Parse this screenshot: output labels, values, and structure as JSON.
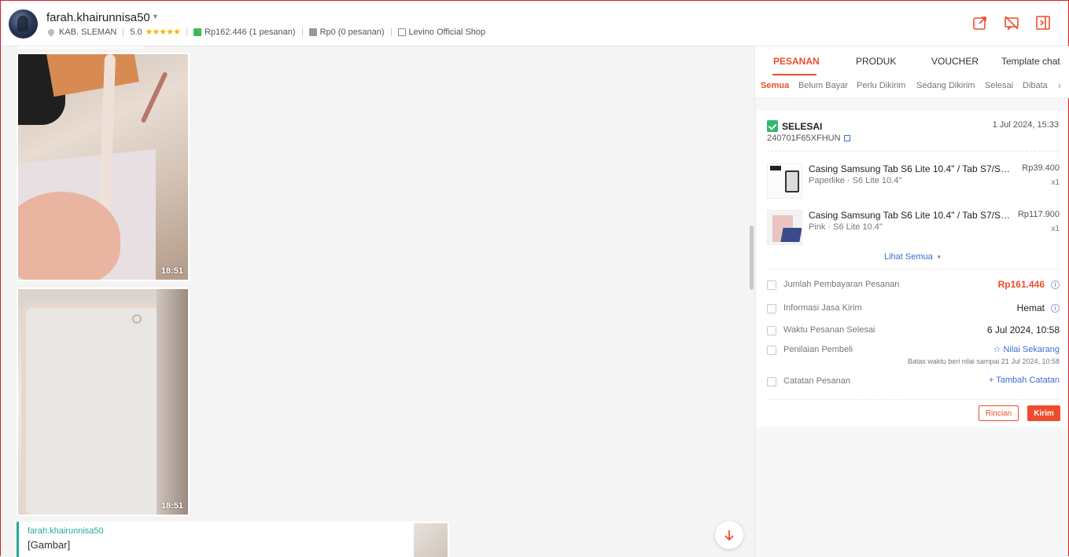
{
  "header": {
    "username": "farah.khairunnisa50",
    "location": "KAB. SLEMAN",
    "rating": "5.0",
    "stars": "★★★★★",
    "spent": "Rp162.446 (1 pesanan)",
    "unpaid": "Rp0 (0 pesanan)",
    "shop": "Levino Official Shop",
    "accent_color": "#ee4d2d"
  },
  "chat": {
    "image_messages": [
      {
        "time": "18:51"
      },
      {
        "time": "18:51"
      }
    ],
    "reply": {
      "name": "farah.khairunnisa50",
      "text": "[Gambar]"
    }
  },
  "panel": {
    "tabs": [
      "PESANAN",
      "PRODUK",
      "VOUCHER",
      "Template chat"
    ],
    "active_tab": "PESANAN",
    "subtabs": [
      "Semua",
      "Belum Bayar",
      "Perlu Dikirim",
      "Sedang Dikirim",
      "Selesai",
      "Dibata"
    ],
    "active_subtab": "Semua",
    "order": {
      "status": "SELESAI",
      "date": "1 Jul 2024, 15:33",
      "id": "240701F65XFHUN",
      "items": [
        {
          "name": "Casing Samsung Tab S6 Lite 10.4\" / Tab S7/S8/...",
          "variant": "Paperlike · S6 Lite 10.4\"",
          "price": "Rp39.400",
          "qty": "x1"
        },
        {
          "name": "Casing Samsung Tab S6 Lite 10.4\" / Tab S7/S8...",
          "variant": "Pink · S6 Lite 10.4\"",
          "price": "Rp117.900",
          "qty": "x1"
        }
      ],
      "see_all": "Lihat Semua",
      "payment_label": "Jumlah Pembayaran Pesanan",
      "payment_value": "Rp161.446",
      "shipping_label": "Informasi Jasa Kirim",
      "shipping_value": "Hemat",
      "completed_label": "Waktu Pesanan Selesai",
      "completed_value": "6 Jul 2024, 10:58",
      "rating_label": "Penilaian Pembeli",
      "rating_link": "☆ Nilai Sekarang",
      "rating_deadline": "Batas waktu beri nilai sampai 21 Jul 2024, 10:58",
      "note_label": "Catatan Pesanan",
      "note_link": "+ Tambah Catatan",
      "btn_details": "Rincian",
      "btn_send": "Kirim"
    }
  }
}
